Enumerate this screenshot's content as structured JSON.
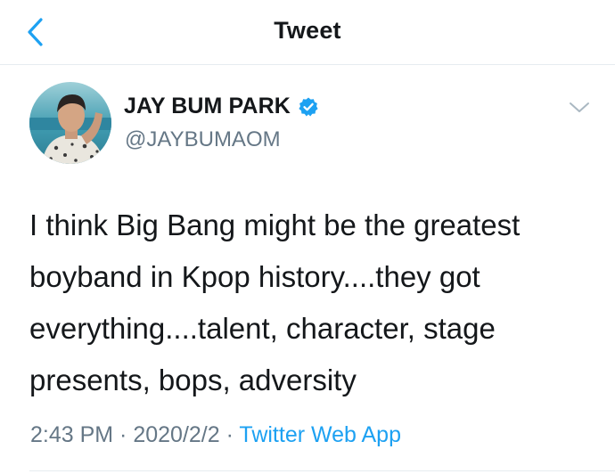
{
  "nav": {
    "title": "Tweet",
    "back_icon": "chevron-left-icon"
  },
  "author": {
    "display_name": "JAY BUM PARK",
    "handle": "@JAYBUMAOM",
    "verified": true,
    "verified_icon": "verified-badge-icon"
  },
  "tweet": {
    "text_lines": [
      "I think Big Bang might be the greatest",
      "boyband in Kpop history....they got",
      "everything....talent, character, stage",
      "presents, bops, adversity"
    ]
  },
  "meta": {
    "time": "2:43 PM",
    "separator": " · ",
    "date": "2020/2/2",
    "source": "Twitter Web App"
  },
  "colors": {
    "accent": "#1da1f2",
    "secondary_text": "#657786",
    "primary_text": "#14171a",
    "divider": "#e6ecf0"
  }
}
